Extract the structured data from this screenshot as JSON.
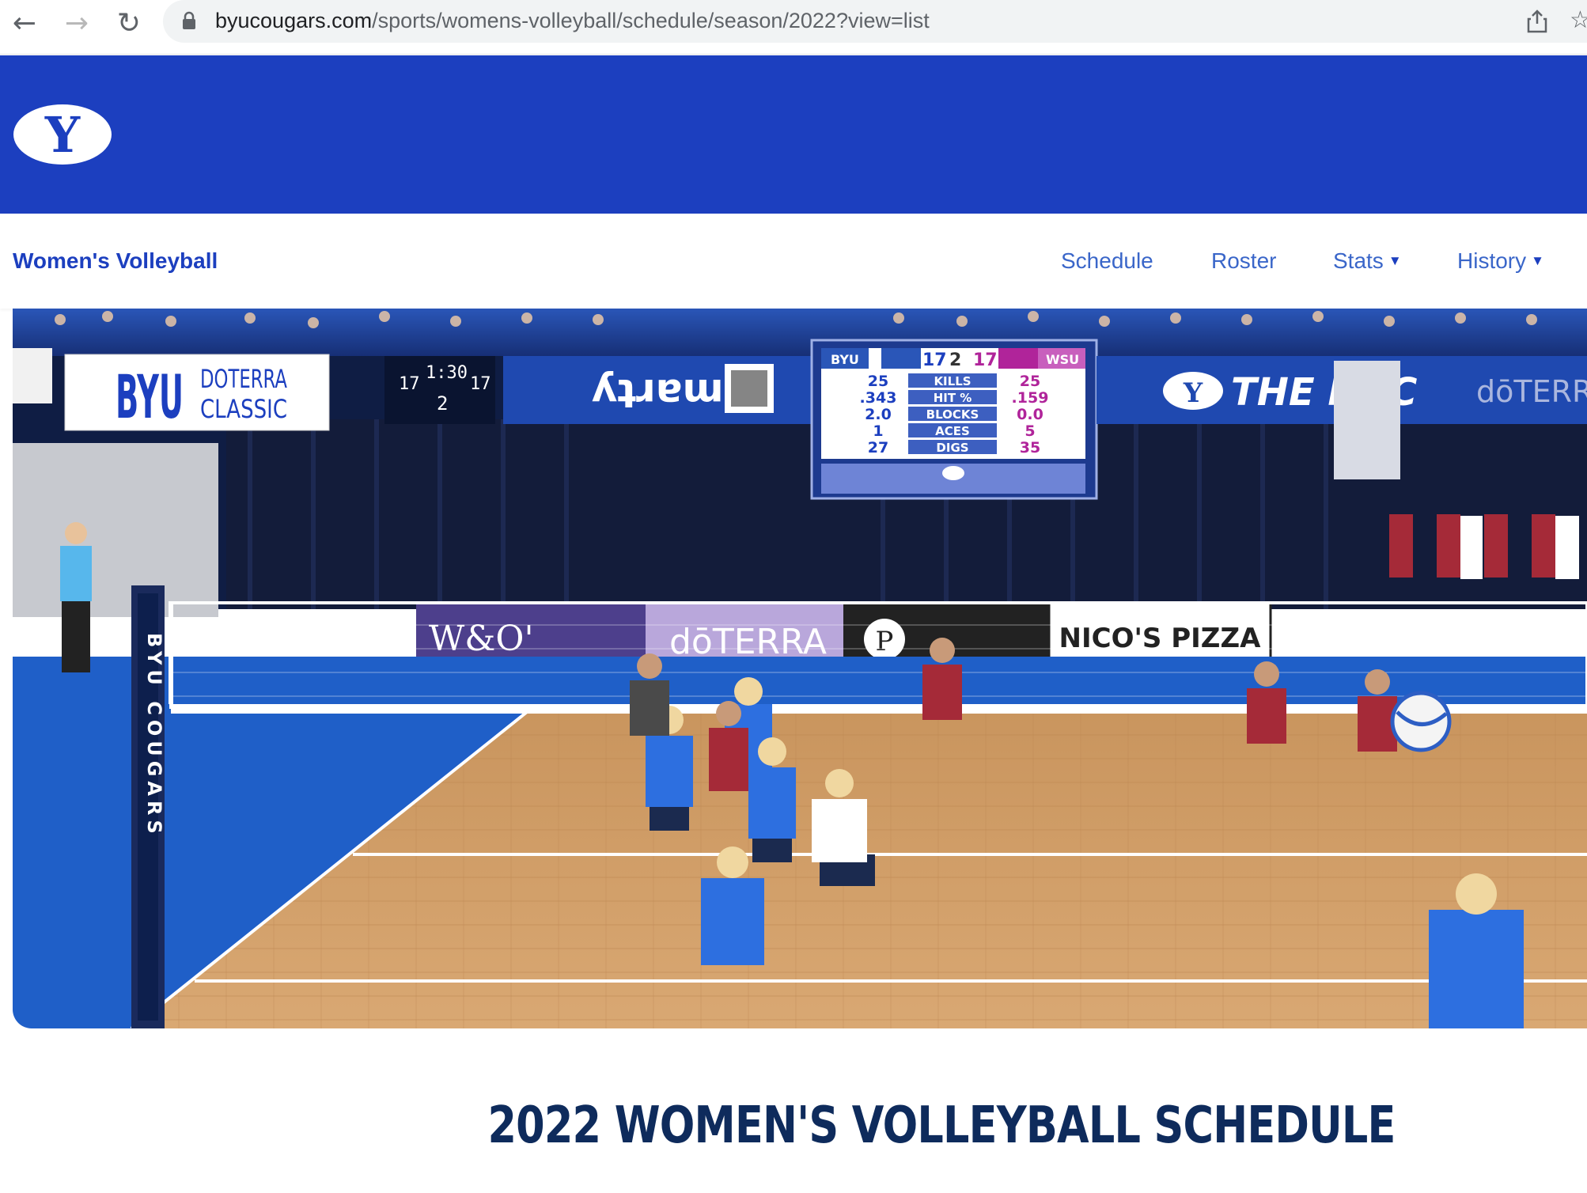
{
  "browser": {
    "url_host": "byucougars.com",
    "url_path": "/sports/womens-volleyball/schedule/season/2022?view=list"
  },
  "site": {
    "brand_color": "#1c3fbf",
    "logo_letter": "Y"
  },
  "subnav": {
    "sport_title": "Women's Volleyball",
    "items": [
      {
        "label": "Schedule",
        "has_dropdown": false
      },
      {
        "label": "Roster",
        "has_dropdown": false
      },
      {
        "label": "Stats",
        "has_dropdown": true
      },
      {
        "label": "History",
        "has_dropdown": true
      }
    ]
  },
  "hero": {
    "banner_left": "BYU",
    "banner_left_sub": "DOTERRA CLASSIC",
    "sponsor_smarty": "smarty",
    "scoreboard": {
      "home": "BYU",
      "away": "WSU",
      "home_sets": "17",
      "set": "2",
      "away_sets": "17",
      "rows": [
        {
          "home": "25",
          "stat": "KILLS",
          "away": "25"
        },
        {
          "home": ".343",
          "stat": "HIT %",
          "away": ".159"
        },
        {
          "home": "2.0",
          "stat": "BLOCKS",
          "away": "0.0"
        },
        {
          "home": "1",
          "stat": "ACES",
          "away": "5"
        },
        {
          "home": "27",
          "stat": "DIGS",
          "away": "35"
        }
      ]
    },
    "small_clock": {
      "home": "17",
      "time": "1:30",
      "guest": "17",
      "period": "2"
    },
    "banner_right": "THE ROC",
    "sponsor_doterra": "dōTERRA",
    "court_ads": [
      "W&O'",
      "dōTERRA",
      "P",
      "NICO'S PIZZA"
    ],
    "pole_text": "BYU COUGARS"
  },
  "page": {
    "heading": "2022 WOMEN'S VOLLEYBALL SCHEDULE"
  }
}
